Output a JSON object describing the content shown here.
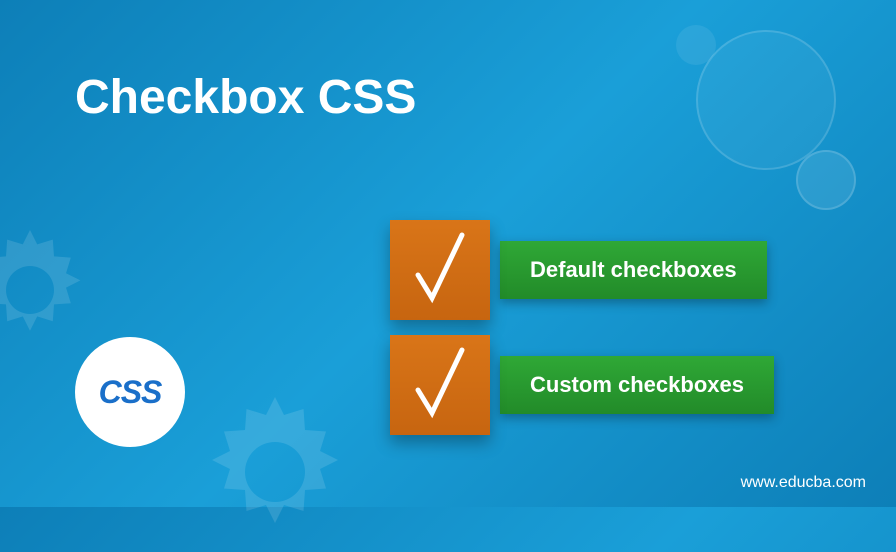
{
  "title": "Checkbox CSS",
  "badge": "CSS",
  "items": [
    {
      "label": "Default checkboxes"
    },
    {
      "label": "Custom checkboxes"
    }
  ],
  "website": "www.educba.com"
}
